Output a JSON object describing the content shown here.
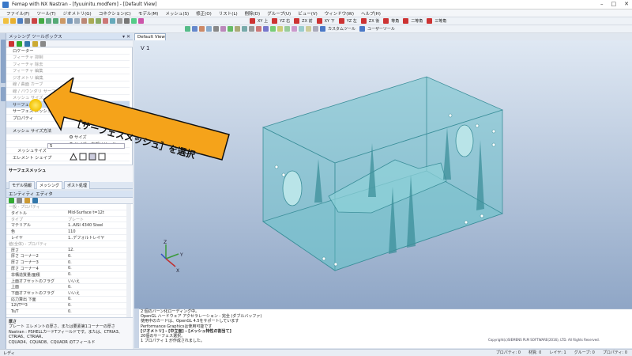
{
  "window": {
    "title": "Femap with NX Nastran - [fyuuinitu.modfem] - [Default View]"
  },
  "menu": [
    "ファイル(F)",
    "ツール(T)",
    "ジオメトリ(G)",
    "コネクション(C)",
    "モデル(M)",
    "メッシュ(S)",
    "修正(O)",
    "リスト(L)",
    "削除(D)",
    "グループ(U)",
    "ビュー(V)",
    "ウィンドウ(W)",
    "ヘルプ(H)"
  ],
  "toolbar": {
    "view_buttons": [
      "XY 上",
      "YZ 右",
      "ZX 前",
      "XY 下",
      "YZ 左",
      "ZX 後",
      "等角",
      "二等角",
      "三等角"
    ],
    "custom_label": "カスタムツール",
    "user_label": "ユーザーツール"
  },
  "meshing_toolbox": {
    "title": "メッシング ツールボックス",
    "items": [
      {
        "label": "ロケーター",
        "state": "normal"
      },
      {
        "label": "フィーチャ 抑制",
        "state": "grey"
      },
      {
        "label": "フィーチャ 除去",
        "state": "grey"
      },
      {
        "label": "フィーチャ 編集",
        "state": "grey"
      },
      {
        "label": "ジオメトリ 編集",
        "state": "grey"
      },
      {
        "label": "線 / 曲面 カーブ",
        "state": "grey"
      },
      {
        "label": "線 / バウンダリ サーフェス",
        "state": "grey"
      },
      {
        "label": "メッシュ サイズ",
        "state": "grey"
      },
      {
        "label": "サーフェス",
        "state": "selected"
      },
      {
        "label": "サーフェス メッシュ",
        "state": "normal"
      },
      {
        "label": "プロパティ",
        "state": "normal"
      }
    ],
    "mesh_size_method_label": "メッシュ サイズ方法",
    "radio_1": "サイズ",
    "radio_2": "サイズ、内部ソリッド",
    "mesh_size_label": "メッシュサイズ",
    "mesh_size_value": "5",
    "element_shape_label": "エレメント シェイプ",
    "description_title": "サーフェスメッシュ"
  },
  "left_tabs": [
    "モデル情報",
    "メッシング",
    "ポスト処理"
  ],
  "entity_editor": {
    "title": "エンティティ エディタ",
    "rows": [
      {
        "k": "一般 - プロパティ",
        "v": "",
        "type": "sec"
      },
      {
        "k": "タイトル",
        "v": "Mid-Surface t=12t",
        "type": "row"
      },
      {
        "k": "タイプ",
        "v": "プレート",
        "type": "grey"
      },
      {
        "k": "マテリアル",
        "v": "1..AISI 4340 Steel",
        "type": "row"
      },
      {
        "k": "色",
        "v": "110",
        "type": "row"
      },
      {
        "k": "レイヤ",
        "v": "1..デフォルトレイヤ",
        "type": "row"
      },
      {
        "k": "値(全体) - プロパティ",
        "v": "",
        "type": "sec"
      },
      {
        "k": "厚さ",
        "v": "12.",
        "type": "row"
      },
      {
        "k": "厚さ コーナー2",
        "v": "0.",
        "type": "row"
      },
      {
        "k": "厚さ コーナー3",
        "v": "0.",
        "type": "row"
      },
      {
        "k": "厚さ コーナー4",
        "v": "0.",
        "type": "row"
      },
      {
        "k": "非構造質量/面積",
        "v": "0.",
        "type": "row"
      },
      {
        "k": "上面オフセットのフラグ",
        "v": "いいえ",
        "type": "row"
      },
      {
        "k": "上面",
        "v": "0.",
        "type": "row"
      },
      {
        "k": "下面オフセットのフラグ",
        "v": "いいえ",
        "type": "row"
      },
      {
        "k": "応力算出 下面",
        "v": "0.",
        "type": "row"
      },
      {
        "k": "12I/T**3",
        "v": "0.",
        "type": "row"
      },
      {
        "k": "Ts/T",
        "v": "0.",
        "type": "row"
      }
    ],
    "desc_title": "厚さ",
    "desc_lines": [
      "プレート エレメントの厚さ、または要素第1コーナーの厚さ",
      "Nastran : PSHELLカードTフィールドです。または、CTRIA3、CTRIA6、CTRIAR、",
      "CQUAD4、CQUAD8、CQUADR のTフィールド"
    ]
  },
  "viewport": {
    "tab": "Default View",
    "label": "V 1",
    "copyright": "Copyright(c)SIEMENS PLM SOFTWARE(2016), LTD. All Rights Reserved."
  },
  "callout": {
    "text": "［サーフェスメッシュ］を選択"
  },
  "messages": [
    {
      "t": "2 個のバーン化ローディング中。",
      "b": false
    },
    {
      "t": "OpenGL ハードウェア アクセラレーション - 完全 (ダブルバッファ)",
      "b": false
    },
    {
      "t": "使用中のカードは、OpenGL 4.5をサポートしています",
      "b": false
    },
    {
      "t": "Performance Graphicsは使用可能です",
      "b": false
    },
    {
      "t": "[ジオメトリ] - [中立面] - [メッシュ特性の割当て]",
      "b": true
    },
    {
      "t": "20個のサーフェス選択。",
      "b": false
    },
    {
      "t": "1 プロパティ 1 が作成されました。",
      "b": false
    }
  ],
  "status": {
    "left": "レディ",
    "items": [
      "プロパティ: 0",
      "材質: 0",
      "レイヤ: 1",
      "グループ: 0",
      "プロパティ: 0"
    ]
  },
  "colors": {
    "accent": "#3a78c8",
    "callout": "#f5a31a",
    "model": "#6fc3cc"
  }
}
